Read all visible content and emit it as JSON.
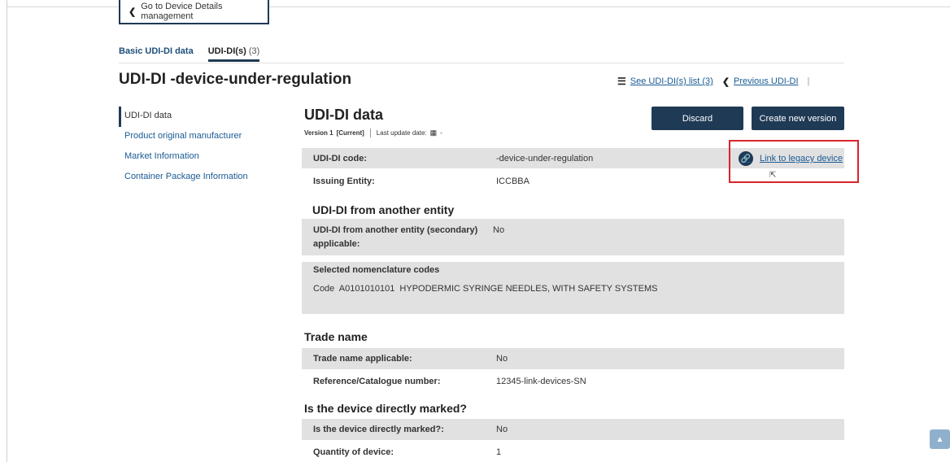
{
  "back_button": {
    "label": "Go to Device Details management"
  },
  "tabs": [
    {
      "label": "Basic UDI-DI data",
      "count": ""
    },
    {
      "label": "UDI-DI(s)",
      "count": "(3)"
    }
  ],
  "page_title": "UDI-DI -device-under-regulation",
  "topnav": {
    "see_list": "See UDI-DI(s) list (3)",
    "previous": "Previous UDI-DI",
    "separator": "|"
  },
  "sidebar": {
    "items": [
      {
        "label": "UDI-DI data",
        "active": true
      },
      {
        "label": "Product original manufacturer",
        "active": false
      },
      {
        "label": "Market Information",
        "active": false
      },
      {
        "label": "Container Package Information",
        "active": false
      }
    ]
  },
  "section": {
    "title": "UDI-DI data",
    "version_label": "Version 1",
    "version_status": "[Current]",
    "last_update_label": "Last update date:",
    "last_update_value": "-"
  },
  "buttons": {
    "discard": "Discard",
    "create": "Create new version"
  },
  "fields": {
    "udi_code": {
      "label": "UDI-DI code:",
      "value": "-device-under-regulation"
    },
    "issuing_entity": {
      "label": "Issuing Entity:",
      "value": "ICCBBA"
    },
    "legacy_link": "Link to legacy device"
  },
  "another_entity": {
    "title": "UDI-DI from another entity",
    "secondary_label_1": "UDI-DI from another entity (secondary)",
    "secondary_label_2": "applicable:",
    "secondary_value": "No",
    "nomenclature_label": "Selected nomenclature codes",
    "nomenclature_value": "Code  A0101010101  HYPODERMIC SYRINGE NEEDLES, WITH SAFETY SYSTEMS"
  },
  "trade_name": {
    "title": "Trade name",
    "applicable_label": "Trade name applicable:",
    "applicable_value": "No",
    "reference_label": "Reference/Catalogue number:",
    "reference_value": "12345-link-devices-SN"
  },
  "direct_marking": {
    "title": "Is the device directly marked?",
    "marked_label": "Is the device directly marked?:",
    "marked_value": "No",
    "quantity_label": "Quantity of device:",
    "quantity_value": "1"
  },
  "colors": {
    "primary": "#1f3a55",
    "link": "#1a5b94",
    "highlight": "#d9242b",
    "row_shade": "#e1e1e1"
  },
  "icons": {
    "back": "chevron-left-icon",
    "list": "list-icon",
    "previous": "chevron-left-icon",
    "calendar": "calendar-icon",
    "link": "link-icon",
    "cursor": "mouse-pointer-icon",
    "scroll_top": "chevron-up-icon"
  }
}
